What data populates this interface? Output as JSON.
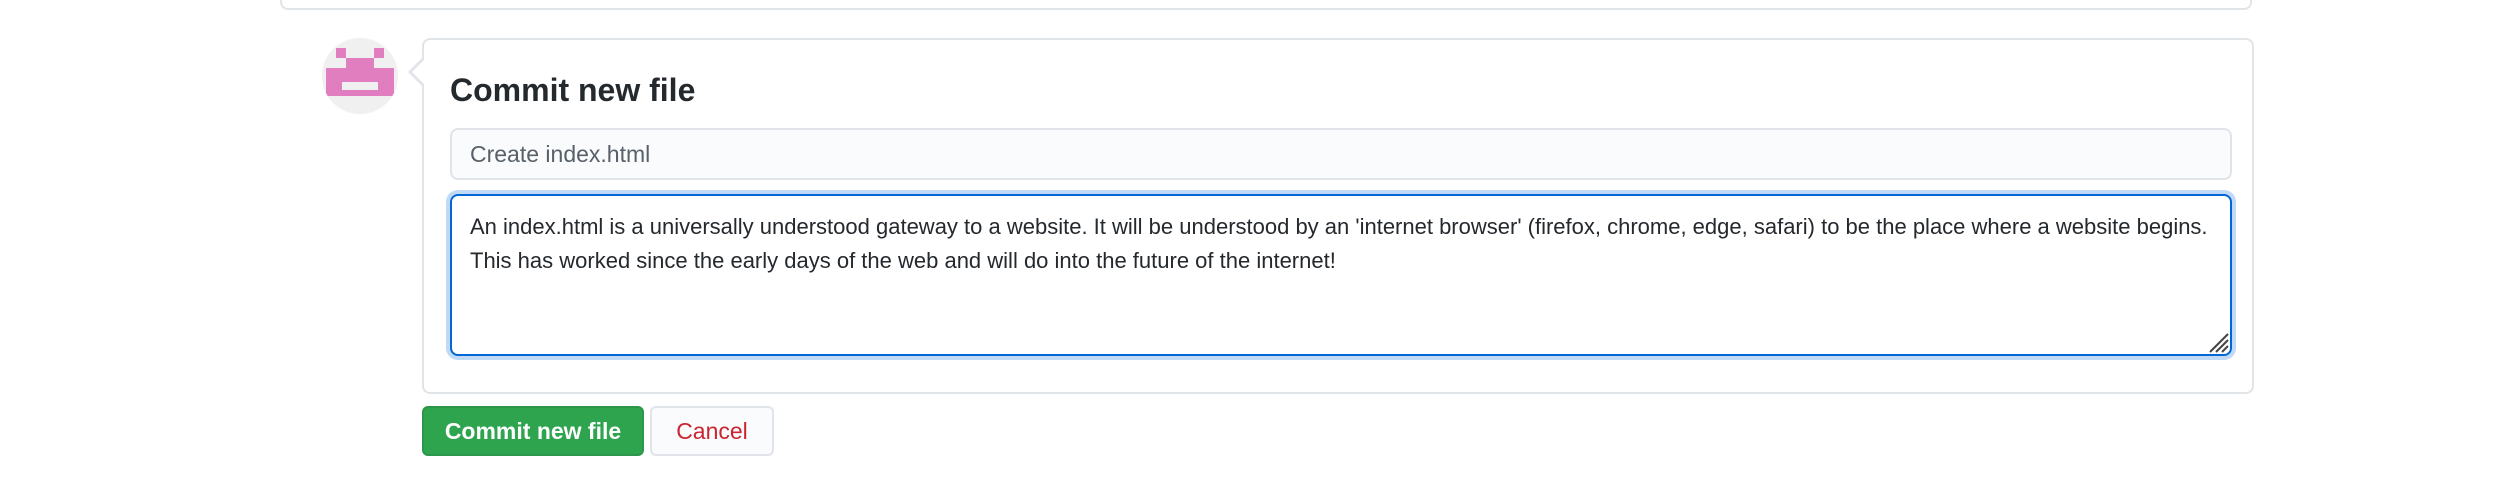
{
  "commit": {
    "title": "Commit new file",
    "summary_placeholder": "Create index.html",
    "summary_value": "",
    "description_value": "An index.html is a universally understood gateway to a website. It will be understood by an 'internet browser' (firefox, chrome, edge, safari) to be the place where a website begins. This has worked since the early days of the web and will do into the future of the internet!"
  },
  "buttons": {
    "commit_label": "Commit new file",
    "cancel_label": "Cancel"
  },
  "colors": {
    "primary": "#2ea44f",
    "danger": "#cb2431",
    "focus": "#0366d6",
    "avatar_accent": "#e07ec0"
  },
  "icons": {
    "avatar": "identicon-avatar",
    "resize": "resize-grip-icon"
  }
}
